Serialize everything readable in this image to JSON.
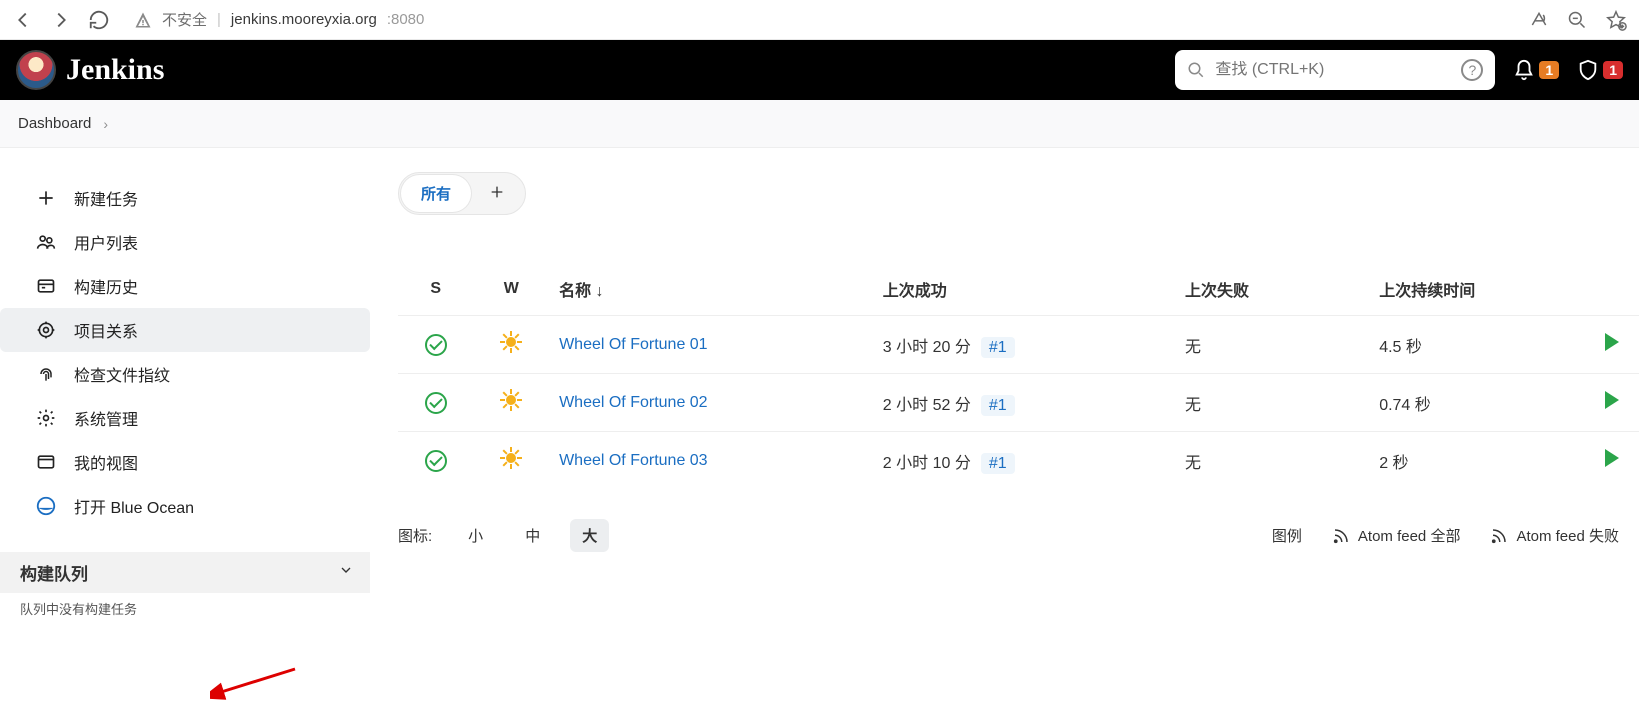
{
  "browser": {
    "insecure_label": "不安全",
    "domain": "jenkins.mooreyxia.org",
    "port": ":8080"
  },
  "header": {
    "app_name": "Jenkins",
    "search_placeholder": "查找 (CTRL+K)",
    "notif_count": "1",
    "alert_count": "1"
  },
  "breadcrumb": {
    "root": "Dashboard"
  },
  "sidebar": {
    "items": [
      {
        "label": "新建任务"
      },
      {
        "label": "用户列表"
      },
      {
        "label": "构建历史"
      },
      {
        "label": "项目关系"
      },
      {
        "label": "检查文件指纹"
      },
      {
        "label": "系统管理"
      },
      {
        "label": "我的视图"
      },
      {
        "label": "打开 Blue Ocean"
      }
    ],
    "queue_title": "构建队列",
    "queue_empty": "队列中没有构建任务"
  },
  "views": {
    "all": "所有"
  },
  "table": {
    "headers": {
      "s": "S",
      "w": "W",
      "name": "名称 ↓",
      "last_success": "上次成功",
      "last_fail": "上次失败",
      "last_duration": "上次持续时间"
    },
    "rows": [
      {
        "name": "Wheel Of Fortune 01",
        "last_success": "3 小时 20 分",
        "build": "#1",
        "last_fail": "无",
        "duration": "4.5 秒"
      },
      {
        "name": "Wheel Of Fortune 02",
        "last_success": "2 小时 52 分",
        "build": "#1",
        "last_fail": "无",
        "duration": "0.74 秒"
      },
      {
        "name": "Wheel Of Fortune 03",
        "last_success": "2 小时 10 分",
        "build": "#1",
        "last_fail": "无",
        "duration": "2 秒"
      }
    ]
  },
  "footer": {
    "icon_label": "图标:",
    "sizes": {
      "s": "小",
      "m": "中",
      "l": "大"
    },
    "legend": "图例",
    "atom_all": "Atom feed 全部",
    "atom_fail": "Atom feed 失败"
  }
}
